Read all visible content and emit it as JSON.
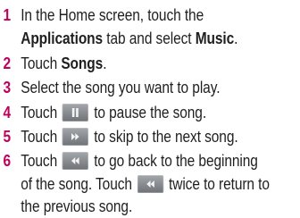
{
  "steps": [
    {
      "num": "1",
      "line1": "In the Home screen, touch the",
      "bold1": "Applications",
      "mid1": " tab and select ",
      "bold2": "Music",
      "end1": "."
    },
    {
      "num": "2",
      "pre": "Touch ",
      "bold": "Songs",
      "post": "."
    },
    {
      "num": "3",
      "text": "Select the song you want to play."
    },
    {
      "num": "4",
      "pre": "Touch ",
      "post": " to pause the song.",
      "icon": "pause-icon"
    },
    {
      "num": "5",
      "pre": "Touch ",
      "post": " to skip to the next song.",
      "icon": "fast-forward-icon"
    },
    {
      "num": "6",
      "pre": "Touch ",
      "post": " to go back to the beginning",
      "line2pre": "of the song. Touch ",
      "line2post": " twice to return to",
      "line3": "the previous song.",
      "icon": "rewind-icon"
    }
  ],
  "colors": {
    "accent": "#c0005a",
    "text": "#1f1f1f",
    "button": "#8a8d92"
  }
}
